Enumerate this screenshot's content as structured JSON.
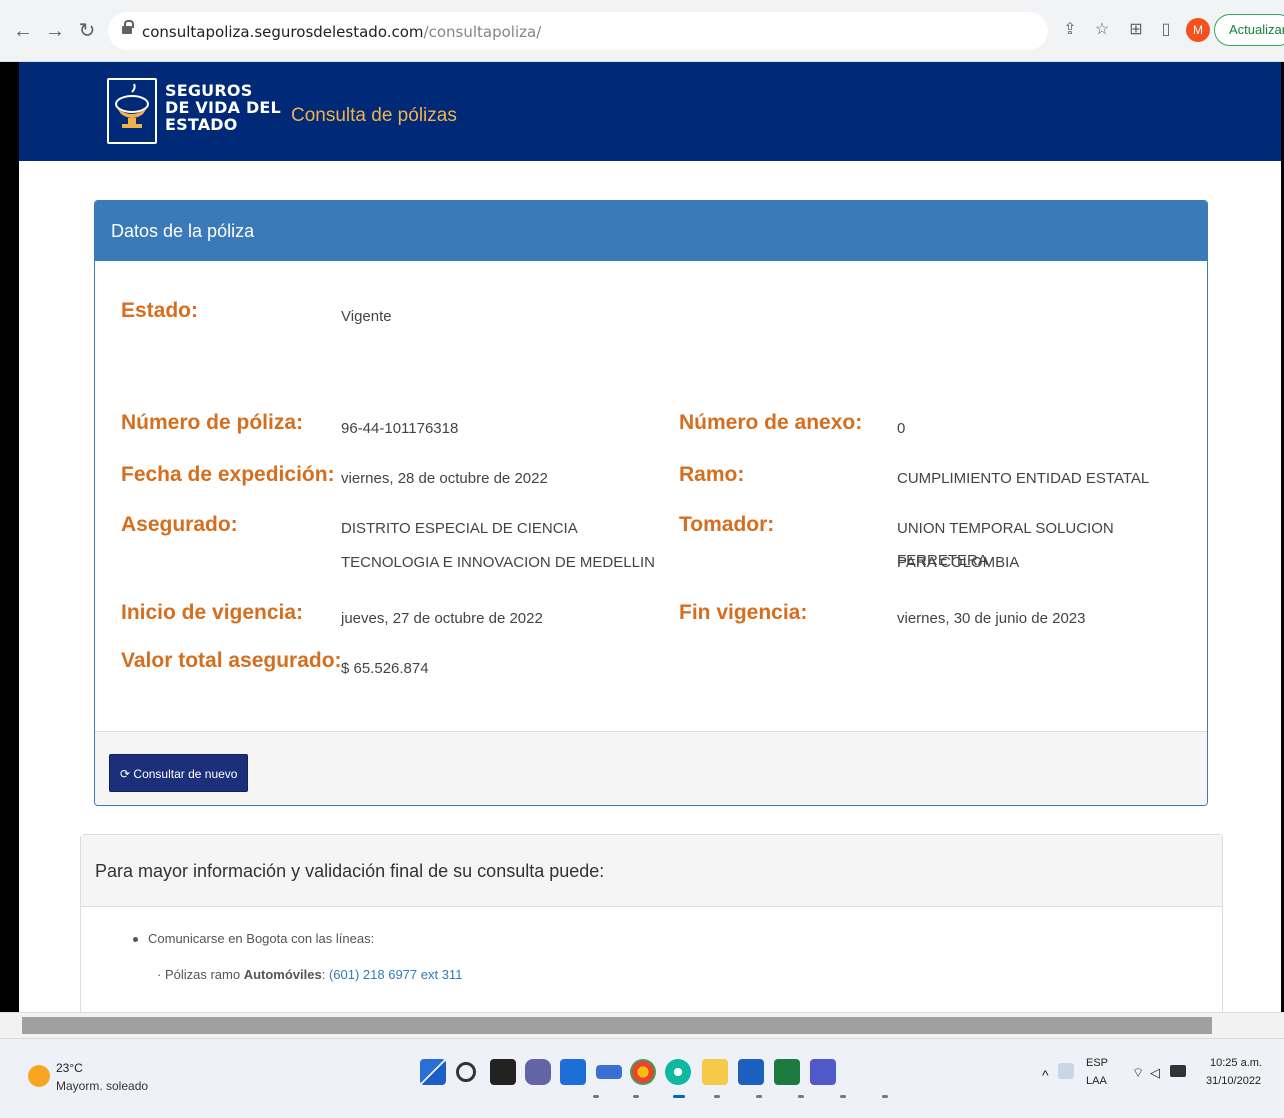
{
  "browser": {
    "url_host": "consultapoliza.segurosdelestado.com",
    "url_path": "/consultapoliza/",
    "profile_initial": "M",
    "update_label": "Actualizar"
  },
  "site": {
    "logo_line1": "SEGUROS",
    "logo_line2": "DE VIDA DEL",
    "logo_line3": "ESTADO",
    "title": "Consulta de pólizas"
  },
  "panel": {
    "heading": "Datos de la póliza",
    "estado_label": "Estado:",
    "estado_value": "Vigente",
    "numero_poliza_label": "Número de póliza:",
    "numero_poliza_value": "96-44-101176318",
    "numero_anexo_label": "Número de anexo:",
    "numero_anexo_value": "0",
    "fecha_expedicion_label": "Fecha de expedición:",
    "fecha_expedicion_value": "viernes, 28 de octubre de 2022",
    "ramo_label": "Ramo:",
    "ramo_value": "CUMPLIMIENTO ENTIDAD ESTATAL",
    "asegurado_label": "Asegurado:",
    "asegurado_value_1": "DISTRITO ESPECIAL DE CIENCIA",
    "asegurado_value_2": "TECNOLOGIA E INNOVACION DE MEDELLIN",
    "tomador_label": "Tomador:",
    "tomador_value_1": "UNION TEMPORAL SOLUCION FERRETERA",
    "tomador_value_2": "PARA COLOMBIA",
    "inicio_vigencia_label": "Inicio de vigencia:",
    "inicio_vigencia_value": "jueves, 27 de octubre de 2022",
    "fin_vigencia_label": "Fin vigencia:",
    "fin_vigencia_value": "viernes, 30 de junio de 2023",
    "valor_label": "Valor total asegurado:",
    "valor_value": "$ 65.526.874",
    "consult_button": "Consultar de nuevo"
  },
  "info": {
    "heading": "Para mayor información y validación final de su consulta puede:",
    "line1": "Comunicarse en Bogota con las líneas:",
    "line2_prefix": "· Pólizas ramo ",
    "line2_bold": "Automóviles",
    "line2_sep": ": ",
    "line2_phone": "(601) 218 6977 ext 311"
  },
  "taskbar": {
    "temp": "23°C",
    "weather": "Mayorm. soleado",
    "lang1": "ESP",
    "lang2": "LAA",
    "time": "10:25 a.m.",
    "date": "31/10/2022"
  },
  "colors": {
    "header_bg": "#002a77",
    "panel_head": "#3a7ab8",
    "label": "#d56f1f",
    "button": "#1c2f7a",
    "link": "#337ab7"
  }
}
